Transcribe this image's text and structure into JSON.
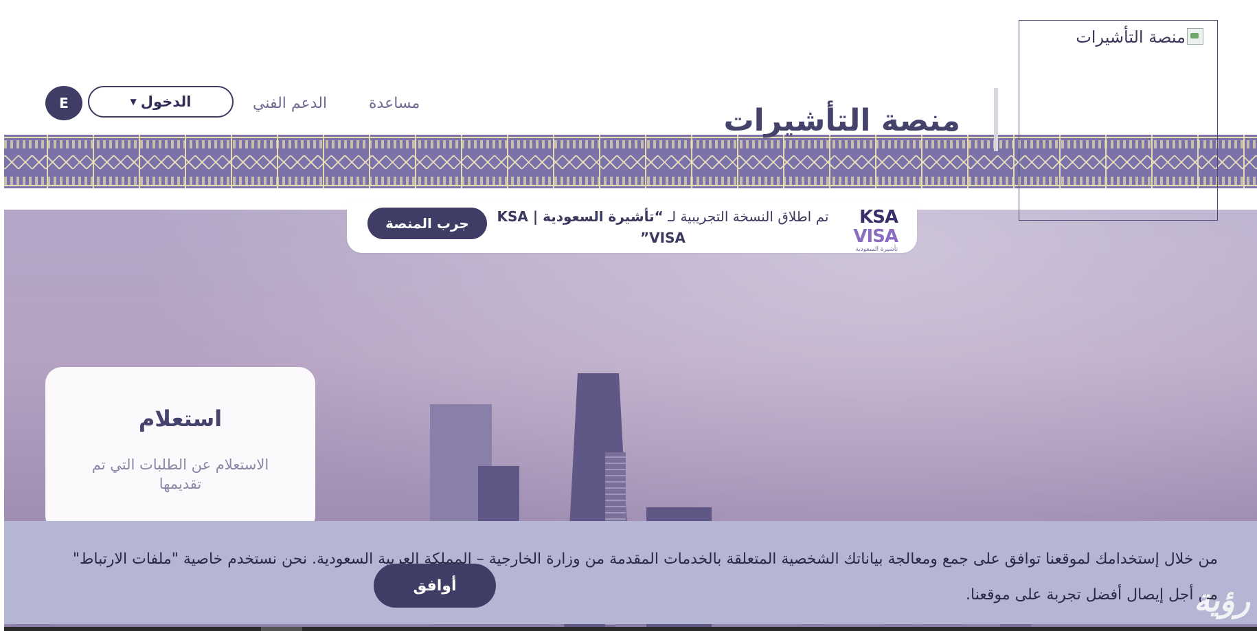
{
  "header": {
    "logo_alt": "منصة التأشيرات",
    "site_title": "منصة التأشيرات",
    "nav": {
      "help": "مساعدة",
      "support": "الدعم الفني"
    },
    "login_label": "الدخول",
    "language_label": "E"
  },
  "announcement": {
    "logo_line1": "KSA",
    "logo_line2": "VISA",
    "logo_line3": "تأشيرة السعودية",
    "text_prefix": "تم اطلاق النسخة التجريبية لـ ",
    "text_bold": "“تأشيرة السعودية | KSA VISA”",
    "button_label": "جرب المنصة"
  },
  "inquiry_card": {
    "title": "استعلام",
    "description": "الاستعلام عن الطلبات التي تم تقديمها"
  },
  "cookie_notice": {
    "text": "من خلال إستخدامك لموقعنا توافق على جمع ومعالجة بياناتك الشخصية المتعلقة بالخدمات المقدمة من وزارة الخارجية – المملكة العربية السعودية. نحن نستخدم خاصية \"ملفات الارتباط\" من أجل إيصال أفضل تجربة على موقعنا.",
    "agree_label": "أوافق",
    "vision_logo": "رؤية"
  }
}
